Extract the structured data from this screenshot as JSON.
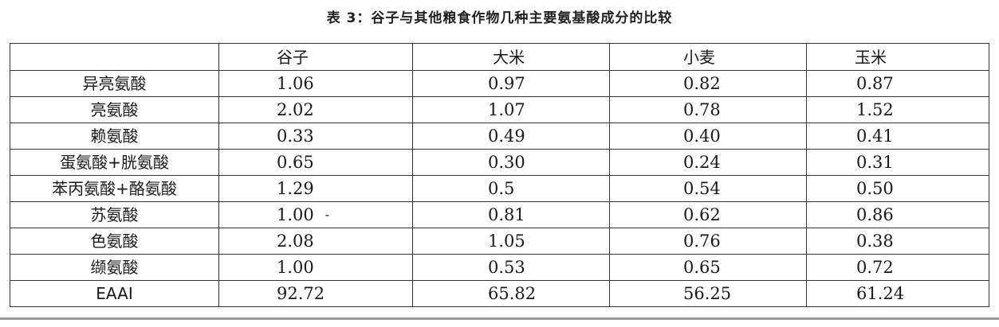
{
  "caption": "表 3：谷子与其他粮食作物几种主要氨基酸成分的比较",
  "table": {
    "corner": "",
    "columns": [
      "谷子",
      "大米",
      "小麦",
      "玉米"
    ],
    "rows": [
      {
        "name": "异亮氨酸",
        "values": [
          "1.06",
          "0.97",
          "0.82",
          "0.87"
        ]
      },
      {
        "name": "亮氨酸",
        "values": [
          "2.02",
          "1.07",
          "0.78",
          "1.52"
        ]
      },
      {
        "name": "赖氨酸",
        "values": [
          "0.33",
          "0.49",
          "0.40",
          "0.41"
        ]
      },
      {
        "name": "蛋氨酸+胱氨酸",
        "values": [
          "0.65",
          "0.30",
          "0.24",
          "0.31"
        ]
      },
      {
        "name": "苯丙氨酸+酪氨酸",
        "values": [
          "1.29",
          "0.5",
          "0.54",
          "0.50"
        ]
      },
      {
        "name": "苏氨酸",
        "values": [
          "1.00",
          "0.81",
          "0.62",
          "0.86"
        ]
      },
      {
        "name": "色氨酸",
        "values": [
          "2.08",
          "1.05",
          "0.76",
          "0.38"
        ]
      },
      {
        "name": "缬氨酸",
        "values": [
          "1.00",
          "0.53",
          "0.65",
          "0.72"
        ]
      },
      {
        "name": "EAAI",
        "values": [
          "92.72",
          "65.82",
          "56.25",
          "61.24"
        ]
      }
    ],
    "stray_mark": "-"
  }
}
